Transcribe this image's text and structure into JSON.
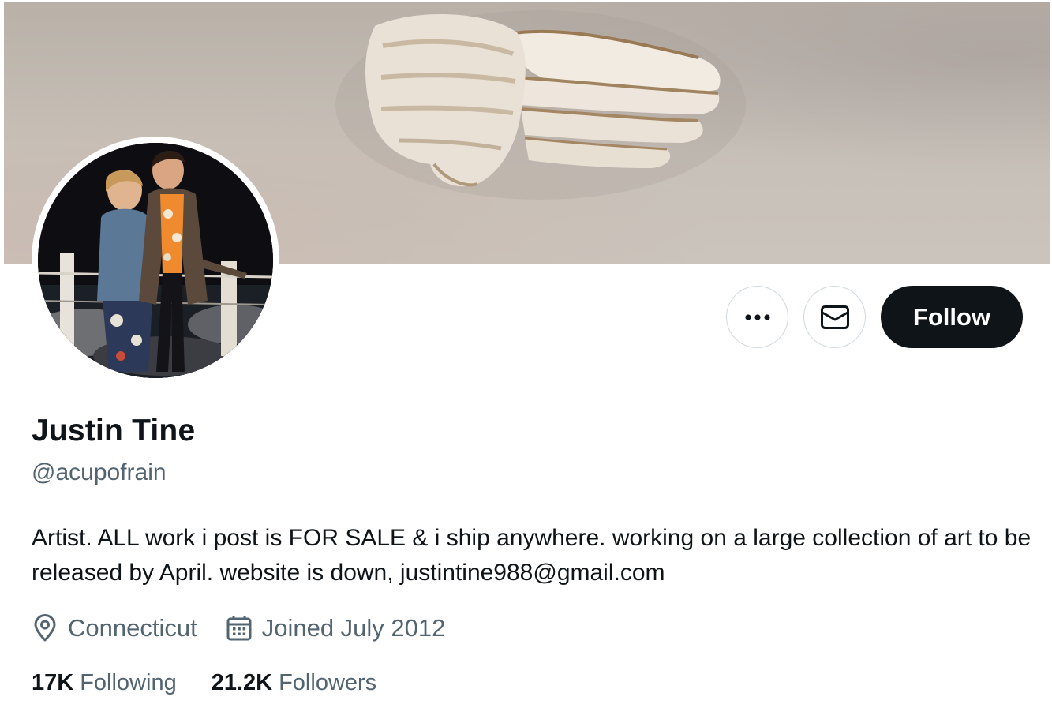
{
  "profile": {
    "display_name": "Justin Tine",
    "handle": "@acupofrain",
    "bio": "Artist. ALL work i post is FOR SALE & i ship anywhere. working on a large collection of art to be released by April. website is down, justintine988@gmail.com",
    "location": "Connecticut",
    "joined": "Joined July 2012"
  },
  "stats": {
    "following_count": "17K",
    "following_label": "Following",
    "followers_count": "21.2K",
    "followers_label": "Followers"
  },
  "actions": {
    "follow_label": "Follow",
    "more_icon": "more-horizontal-icon",
    "message_icon": "envelope-icon"
  },
  "icons": {
    "location": "location-pin-icon",
    "joined": "calendar-icon"
  },
  "colors": {
    "primary_text": "#0f1419",
    "secondary_text": "#536471",
    "button_border": "#cfd9de",
    "follow_bg": "#0f1419",
    "follow_text": "#ffffff"
  }
}
